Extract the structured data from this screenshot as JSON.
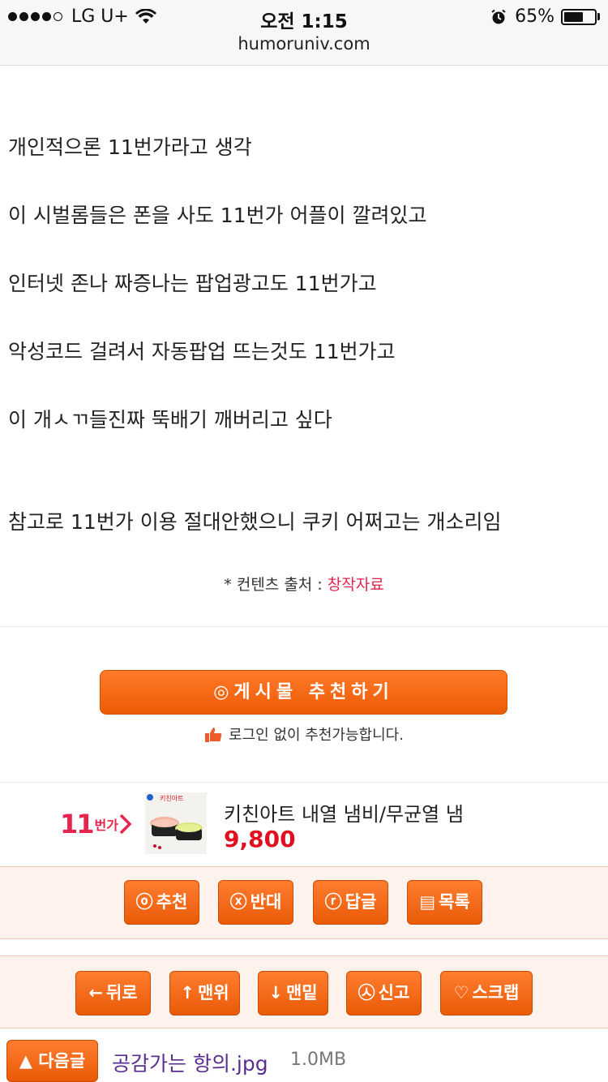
{
  "status_bar": {
    "carrier": "LG U+",
    "time": "오전 1:15",
    "battery_percent": "65%",
    "battery_level": 0.65,
    "url": "humoruniv.com"
  },
  "post": {
    "lines": [
      "개인적으론 11번가라고 생각",
      "이 시벌롬들은 폰을 사도 11번가 어플이 깔려있고",
      "인터넷 존나 짜증나는 팝업광고도 11번가고",
      "악성코드 걸려서 자동팝업 뜨는것도 11번가고",
      "이 개ㅅㄲ들진짜 뚝배기 깨버리고 싶다",
      "참고로 11번가 이용 절대안했으니 쿠키 어쩌고는 개소리임"
    ],
    "source_label": "* 컨텐츠 출처 :",
    "source_link": "창작자료"
  },
  "recommend": {
    "button_label": "◎게시물  추천하기",
    "note": "로그인 없이 추천가능합니다."
  },
  "ad": {
    "logo_number": "11",
    "logo_word": "번가",
    "title": "키친아트 내열 냄비/무균열 냄",
    "price": "9,800",
    "thumb_brand": "키친아트"
  },
  "vote_bar": {
    "buttons": [
      {
        "icon": "ⓞ",
        "label": "추천"
      },
      {
        "icon": "ⓧ",
        "label": "반대"
      },
      {
        "icon": "ⓡ",
        "label": "답글"
      },
      {
        "icon": "▤",
        "label": "목록"
      }
    ]
  },
  "nav_bar": {
    "buttons": [
      {
        "icon": "←",
        "label": "뒤로"
      },
      {
        "icon": "↑",
        "label": "맨위"
      },
      {
        "icon": "↓",
        "label": "맨밑"
      },
      {
        "icon": "㉦",
        "label": "신고"
      },
      {
        "icon": "♡",
        "label": "스크랩"
      }
    ]
  },
  "next_post": {
    "button_label": "▲ 다음글",
    "title": "공감가는 항의.jpg",
    "size": "1.0MB"
  }
}
